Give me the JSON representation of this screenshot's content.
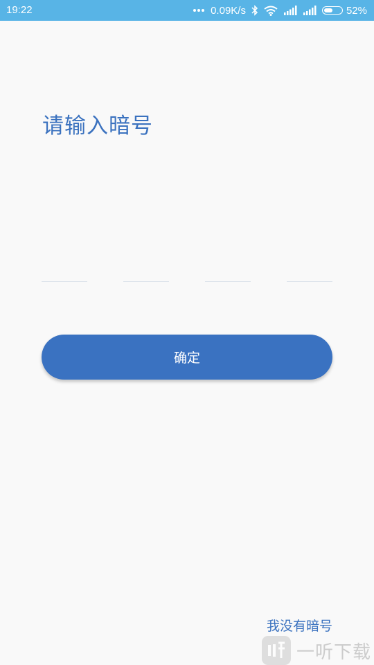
{
  "status_bar": {
    "time": "19:22",
    "network_speed": "0.09K/s",
    "battery": "52%",
    "battery_level": 0.52,
    "icons": [
      "more-dots-icon",
      "bluetooth-icon",
      "wifi-icon",
      "signal-icon",
      "signal-icon",
      "battery-icon"
    ]
  },
  "page": {
    "title": "请输入暗号",
    "code_cells": [
      "",
      "",
      "",
      ""
    ],
    "confirm_label": "确定",
    "no_code_link": "我没有暗号"
  },
  "watermark": {
    "text": "一听下载"
  },
  "colors": {
    "status_bar": "#58b4e6",
    "accent": "#3a72c1",
    "background": "#f9f9f9"
  }
}
